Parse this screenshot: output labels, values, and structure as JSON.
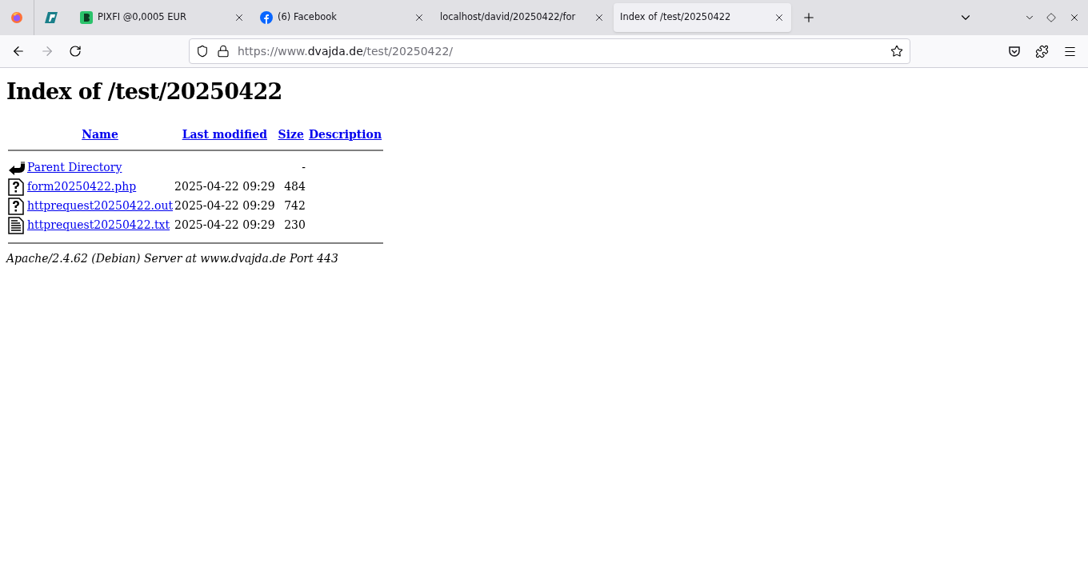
{
  "browser": {
    "pinned_tabs": [
      {
        "kind": "firefox",
        "selected": false
      },
      {
        "kind": "logo",
        "selected": false
      }
    ],
    "tabs": [
      {
        "title": "PIXFI @0,0005 EUR",
        "kind": "pixfi",
        "selected": false
      },
      {
        "title": "(6) Facebook",
        "kind": "facebook",
        "selected": false
      },
      {
        "title": "localhost/david/20250422/for",
        "kind": "none",
        "selected": false
      },
      {
        "title": "Index of /test/20250422",
        "kind": "none",
        "selected": true
      }
    ],
    "url": {
      "scheme": "https://www.",
      "host": "dvajda.de",
      "path": "/test/20250422/"
    }
  },
  "page": {
    "heading": "Index of /test/20250422",
    "columns": [
      "Name",
      "Last modified",
      "Size",
      "Description"
    ],
    "rows": [
      {
        "kind": "back",
        "name": "Parent Directory",
        "modified": "",
        "size": "-"
      },
      {
        "kind": "unknown",
        "name": "form20250422.php",
        "modified": "2025-04-22 09:29",
        "size": "484"
      },
      {
        "kind": "unknown",
        "name": "httprequest20250422.out",
        "modified": "2025-04-22 09:29",
        "size": "742"
      },
      {
        "kind": "text",
        "name": "httprequest20250422.txt",
        "modified": "2025-04-22 09:29",
        "size": "230"
      }
    ],
    "footer": "Apache/2.4.62 (Debian) Server at www.dvajda.de Port 443"
  }
}
